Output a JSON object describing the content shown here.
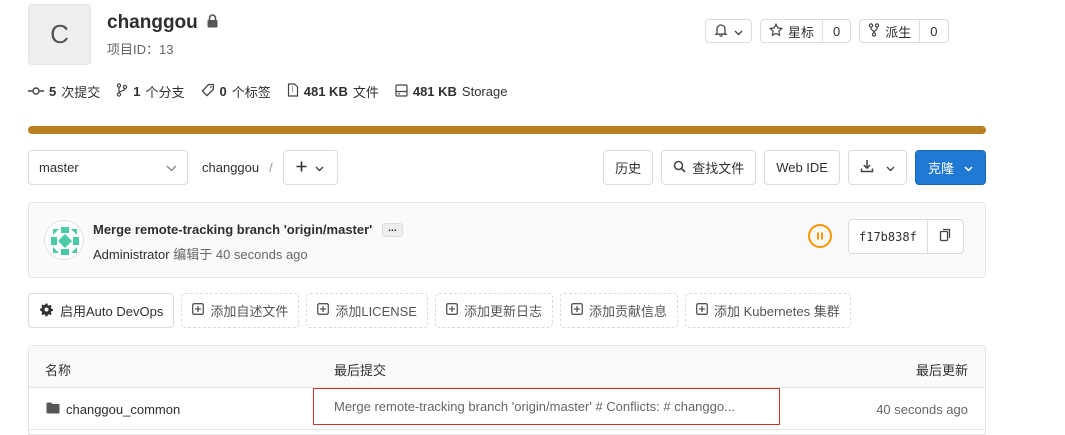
{
  "project": {
    "avatar_letter": "C",
    "name": "changgou",
    "id_label": "项目ID：13"
  },
  "header_buttons": {
    "notification_icon": "bell-icon",
    "star_label": "星标",
    "star_count": "0",
    "fork_label": "派生",
    "fork_count": "0"
  },
  "stats": {
    "commits_count": "5",
    "commits_label": "次提交",
    "branches_count": "1",
    "branches_label": "个分支",
    "tags_count": "0",
    "tags_label": "个标签",
    "files_size": "481 KB",
    "files_label": "文件",
    "storage_size": "481 KB",
    "storage_label": "Storage"
  },
  "language_bar": {
    "color": "#b8801f"
  },
  "nav": {
    "branch": "master",
    "path_root": "changgou",
    "path_sep": "/",
    "history_label": "历史",
    "find_file_label": "查找文件",
    "web_ide_label": "Web IDE",
    "clone_label": "克隆"
  },
  "last_commit": {
    "title": "Merge remote-tracking branch 'origin/master'",
    "ellipsis": "...",
    "author": "Administrator",
    "edited_label": "编辑于",
    "time": "40 seconds ago",
    "sha": "f17b838f"
  },
  "actions": {
    "auto_devops": "启用Auto DevOps",
    "add_readme": "添加自述文件",
    "add_license": "添加LICENSE",
    "add_changelog": "添加更新日志",
    "add_contributing": "添加贡献信息",
    "add_kubernetes": "添加 Kubernetes 集群"
  },
  "file_table": {
    "headers": {
      "name": "名称",
      "last_commit": "最后提交",
      "last_update": "最后更新"
    },
    "rows": [
      {
        "name": "changgou_common",
        "commit_msg": "Merge remote-tracking branch 'origin/master' # Conflicts: # changgo...",
        "updated": "40 seconds ago"
      }
    ]
  },
  "colors": {
    "accent": "#1f78d1",
    "pipeline_pending": "#fc9403",
    "highlight_border": "#c0392b"
  }
}
